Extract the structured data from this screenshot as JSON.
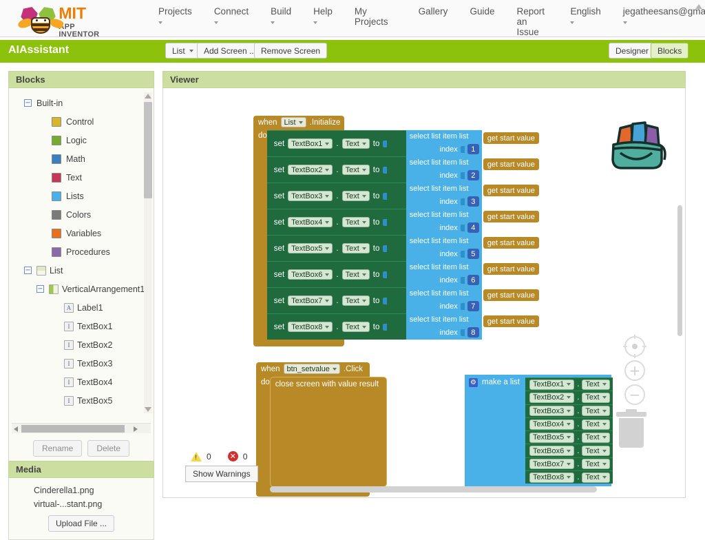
{
  "topnav": {
    "logo": {
      "mit": "MIT",
      "sub": "APP INVENTOR"
    },
    "items": [
      {
        "label": "Projects",
        "caret": true
      },
      {
        "label": "Connect",
        "caret": true
      },
      {
        "label": "Build",
        "caret": true
      },
      {
        "label": "Help",
        "caret": true
      },
      {
        "label": "My Projects",
        "caret": false
      },
      {
        "label": "Gallery",
        "caret": false
      },
      {
        "label": "Guide",
        "caret": false
      },
      {
        "label": "Report an Issue",
        "caret": false
      },
      {
        "label": "English",
        "caret": true
      },
      {
        "label": "jegatheesans@gmail.com",
        "caret": true
      }
    ]
  },
  "projectbar": {
    "title": "AIAssistant",
    "screen_selector": "List",
    "add_screen": "Add Screen ...",
    "remove_screen": "Remove Screen",
    "designer": "Designer",
    "blocks": "Blocks",
    "green": "#8cc20b"
  },
  "blocks_panel": {
    "header": "Blocks",
    "builtin": {
      "label": "Built-in",
      "categories": [
        {
          "label": "Control",
          "color": "#d9b52c"
        },
        {
          "label": "Logic",
          "color": "#77ab2f"
        },
        {
          "label": "Math",
          "color": "#3c7fc1"
        },
        {
          "label": "Text",
          "color": "#c4385c"
        },
        {
          "label": "Lists",
          "color": "#49b0e8"
        },
        {
          "label": "Colors",
          "color": "#7b7b7b"
        },
        {
          "label": "Variables",
          "color": "#e8701a"
        },
        {
          "label": "Procedures",
          "color": "#8a6aa8"
        }
      ]
    },
    "screen": {
      "label": "List"
    },
    "arrangement": {
      "label": "VerticalArrangement1"
    },
    "components": [
      {
        "label": "Label1",
        "icon": "A"
      },
      {
        "label": "TextBox1",
        "icon": "I"
      },
      {
        "label": "TextBox2",
        "icon": "I"
      },
      {
        "label": "TextBox3",
        "icon": "I"
      },
      {
        "label": "TextBox4",
        "icon": "I"
      },
      {
        "label": "TextBox5",
        "icon": "I"
      }
    ],
    "rename": "Rename",
    "delete": "Delete"
  },
  "media_panel": {
    "header": "Media",
    "files": [
      "Cinderella1.png",
      "virtual-...stant.png"
    ],
    "upload": "Upload File ..."
  },
  "viewer": {
    "header": "Viewer",
    "warnings": {
      "warn_count": "0",
      "error_count": "0",
      "show_warnings": "Show Warnings"
    }
  },
  "workspace": {
    "initialize_block": {
      "when": "when",
      "component": "List",
      "event": ".Initialize",
      "do": "do",
      "rows": [
        {
          "set": "set",
          "component": "TextBox1",
          "dot": ".",
          "property": "Text",
          "to": "to",
          "select": "select list item  list",
          "value": "get start value",
          "index_label": "index",
          "index": "1"
        },
        {
          "set": "set",
          "component": "TextBox2",
          "dot": ".",
          "property": "Text",
          "to": "to",
          "select": "select list item  list",
          "value": "get start value",
          "index_label": "index",
          "index": "2"
        },
        {
          "set": "set",
          "component": "TextBox3",
          "dot": ".",
          "property": "Text",
          "to": "to",
          "select": "select list item  list",
          "value": "get start value",
          "index_label": "index",
          "index": "3"
        },
        {
          "set": "set",
          "component": "TextBox4",
          "dot": ".",
          "property": "Text",
          "to": "to",
          "select": "select list item  list",
          "value": "get start value",
          "index_label": "index",
          "index": "4"
        },
        {
          "set": "set",
          "component": "TextBox5",
          "dot": ".",
          "property": "Text",
          "to": "to",
          "select": "select list item  list",
          "value": "get start value",
          "index_label": "index",
          "index": "5"
        },
        {
          "set": "set",
          "component": "TextBox6",
          "dot": ".",
          "property": "Text",
          "to": "to",
          "select": "select list item  list",
          "value": "get start value",
          "index_label": "index",
          "index": "6"
        },
        {
          "set": "set",
          "component": "TextBox7",
          "dot": ".",
          "property": "Text",
          "to": "to",
          "select": "select list item  list",
          "value": "get start value",
          "index_label": "index",
          "index": "7"
        },
        {
          "set": "set",
          "component": "TextBox8",
          "dot": ".",
          "property": "Text",
          "to": "to",
          "select": "select list item  list",
          "value": "get start value",
          "index_label": "index",
          "index": "8"
        }
      ]
    },
    "click_block": {
      "when": "when",
      "component": "btn_setvalue",
      "event": ".Click",
      "do": "do",
      "close_screen": "close screen with value  result",
      "make_a_list": "make a list",
      "items": [
        {
          "component": "TextBox1",
          "dot": ".",
          "property": "Text"
        },
        {
          "component": "TextBox2",
          "dot": ".",
          "property": "Text"
        },
        {
          "component": "TextBox3",
          "dot": ".",
          "property": "Text"
        },
        {
          "component": "TextBox4",
          "dot": ".",
          "property": "Text"
        },
        {
          "component": "TextBox5",
          "dot": ".",
          "property": "Text"
        },
        {
          "component": "TextBox6",
          "dot": ".",
          "property": "Text"
        },
        {
          "component": "TextBox7",
          "dot": ".",
          "property": "Text"
        },
        {
          "component": "TextBox8",
          "dot": ".",
          "property": "Text"
        }
      ]
    },
    "colors": {
      "event_gold": "#b88a27",
      "setter_green": "#1f6b3e",
      "lists_blue": "#49b0e8",
      "number_blue": "#3761b5"
    }
  }
}
